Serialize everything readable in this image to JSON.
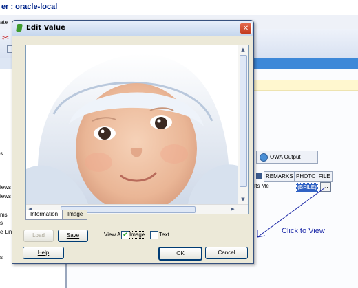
{
  "background": {
    "window_title": "er : oracle-local",
    "toolbar_text": "ate",
    "left_labels": [
      "s",
      "iews",
      "iews",
      "ms",
      "s",
      "e Lin",
      "s"
    ],
    "owa_tab": "OWA Output",
    "columns": [
      "REMARKS",
      "PHOTO_FILE"
    ],
    "remarks_value": "Its Me",
    "photo_file_value": "(BFILE)",
    "ellipsis_label": "...",
    "annotation": "Click to View"
  },
  "dialog": {
    "title": "Edit Value",
    "close_label": "✕",
    "image_alt": "baby in white hooded towel",
    "tabs": [
      "Information",
      "Image"
    ],
    "active_tab": "Information",
    "load_label": "Load",
    "save_label": "Save",
    "view_as_label": "View As:",
    "image_option": "Image",
    "text_option": "Text",
    "image_checked": true,
    "text_checked": false,
    "help_label": "Help",
    "ok_label": "OK",
    "cancel_label": "Cancel"
  },
  "colors": {
    "title_blue": "#00248a",
    "selection_blue": "#3062c4",
    "annotation_blue": "#1d2aa8"
  }
}
